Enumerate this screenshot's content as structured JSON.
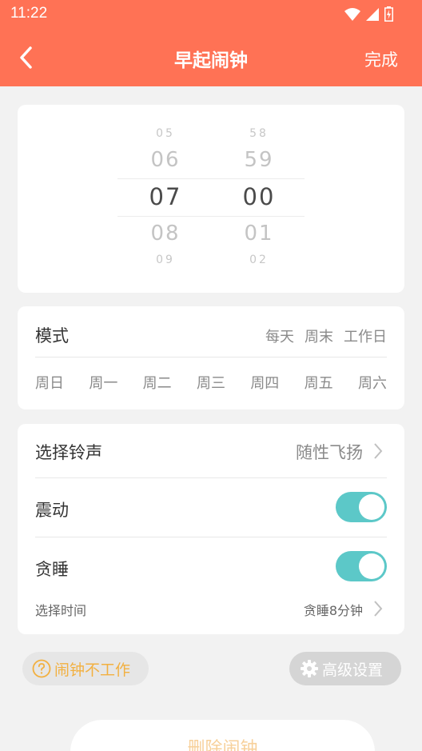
{
  "status_bar": {
    "time": "11:22"
  },
  "header": {
    "title": "早起闹钟",
    "done_label": "完成"
  },
  "picker": {
    "hours": [
      "05",
      "06",
      "07",
      "08",
      "09"
    ],
    "minutes": [
      "58",
      "59",
      "00",
      "01",
      "02"
    ],
    "selected_hour": "07",
    "selected_minute": "00"
  },
  "mode": {
    "label": "模式",
    "options": [
      "每天",
      "周末",
      "工作日"
    ],
    "days": [
      "周日",
      "周一",
      "周二",
      "周三",
      "周四",
      "周五",
      "周六"
    ]
  },
  "settings": {
    "ringtone_label": "选择铃声",
    "ringtone_value": "随性飞扬",
    "vibrate_label": "震动",
    "vibrate_on": true,
    "snooze_label": "贪睡",
    "snooze_on": true,
    "snooze_time_label": "选择时间",
    "snooze_time_value": "贪睡8分钟"
  },
  "actions": {
    "help_label": "闹钟不工作",
    "advanced_label": "高级设置",
    "delete_label": "删除闹钟"
  },
  "colors": {
    "header": "#ff7255",
    "toggle": "#5cc8c8",
    "help_text": "#f2b040"
  },
  "icons": [
    "back-arrow-icon",
    "wifi-icon",
    "signal-icon",
    "battery-icon",
    "chevron-right-icon",
    "help-icon",
    "gear-icon"
  ]
}
